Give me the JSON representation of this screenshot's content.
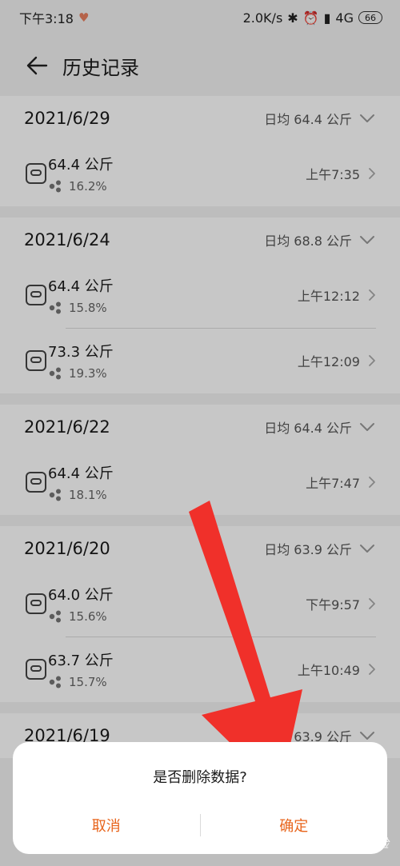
{
  "status": {
    "time": "下午3:18",
    "speed": "2.0K/s",
    "network": "4G",
    "battery": "66"
  },
  "header": {
    "title": "历史记录"
  },
  "groups": [
    {
      "date": "2021/6/29",
      "avg": "日均 64.4  公斤",
      "entries": [
        {
          "weight": "64.4  公斤",
          "fat": "16.2%",
          "time": "上午7:35"
        }
      ]
    },
    {
      "date": "2021/6/24",
      "avg": "日均 68.8  公斤",
      "entries": [
        {
          "weight": "64.4  公斤",
          "fat": "15.8%",
          "time": "上午12:12"
        },
        {
          "weight": "73.3  公斤",
          "fat": "19.3%",
          "time": "上午12:09"
        }
      ]
    },
    {
      "date": "2021/6/22",
      "avg": "日均 64.4  公斤",
      "entries": [
        {
          "weight": "64.4  公斤",
          "fat": "18.1%",
          "time": "上午7:47"
        }
      ]
    },
    {
      "date": "2021/6/20",
      "avg": "日均 63.9  公斤",
      "entries": [
        {
          "weight": "64.0  公斤",
          "fat": "15.6%",
          "time": "下午9:57"
        },
        {
          "weight": "63.7  公斤",
          "fat": "15.7%",
          "time": "上午10:49"
        }
      ]
    },
    {
      "date": "2021/6/19",
      "avg": "日均 63.9  公斤",
      "entries": []
    }
  ],
  "dialog": {
    "message": "是否删除数据?",
    "cancel": "取消",
    "confirm": "确定"
  },
  "watermark": "Baidu 经验",
  "colors": {
    "accent": "#e8641b",
    "annotation": "#f0302a"
  }
}
